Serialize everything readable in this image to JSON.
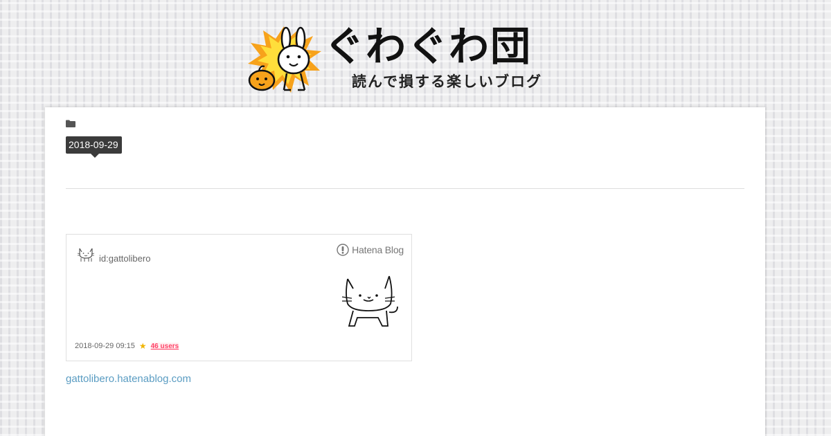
{
  "header": {
    "site_title": "ぐわぐわ団",
    "tagline": "読んで損する楽しいブログ"
  },
  "article": {
    "category_icon": "folder-icon",
    "date": "2018-09-29"
  },
  "embed": {
    "user_id": "id:gattolibero",
    "brand": "Hatena Blog",
    "timestamp": "2018-09-29 09:15",
    "bookmark_icon": "star-icon",
    "bookmark_users": "46 users",
    "accent_color": "#ff4166"
  },
  "source_link": "gattolibero.hatenablog.com"
}
